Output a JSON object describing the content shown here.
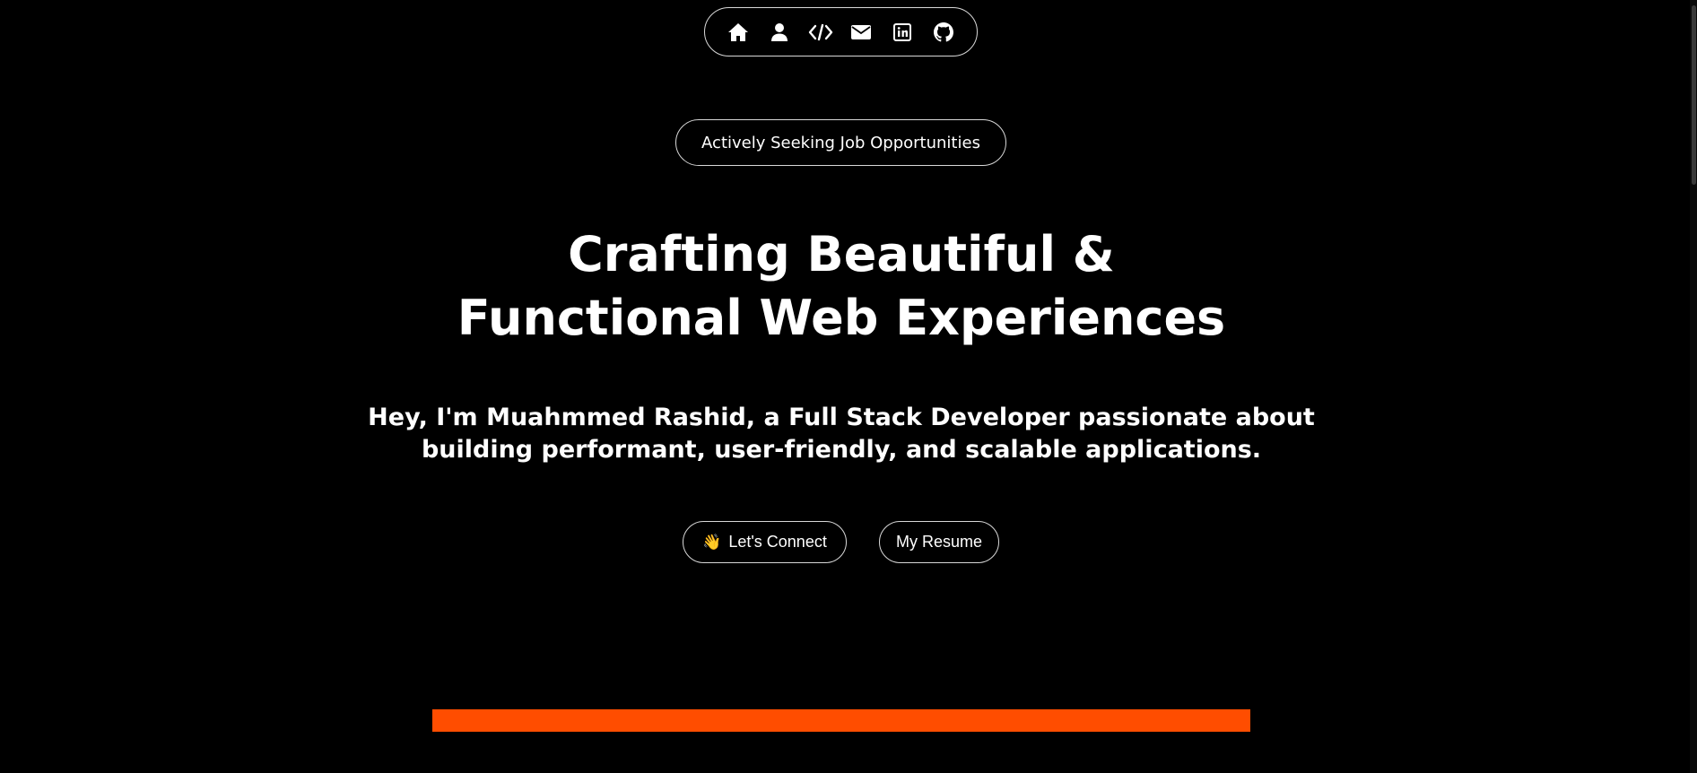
{
  "nav": {
    "items": [
      {
        "icon": "home-icon"
      },
      {
        "icon": "user-icon"
      },
      {
        "icon": "code-icon"
      },
      {
        "icon": "email-icon"
      },
      {
        "icon": "linkedin-icon"
      },
      {
        "icon": "github-icon"
      }
    ]
  },
  "badge": {
    "text": "Actively Seeking Job Opportunities"
  },
  "hero": {
    "headline_line1": "Crafting Beautiful &",
    "headline_line2": "Functional Web Experiences",
    "intro": "Hey, I'm Muahmmed Rashid, a Full Stack Developer passionate about building performant, user-friendly, and scalable applications."
  },
  "buttons": {
    "connect_emoji": "👋",
    "connect_label": "Let's Connect",
    "resume_label": "My Resume"
  },
  "colors": {
    "background": "#000000",
    "text": "#ffffff",
    "accent": "#ff4d00"
  }
}
